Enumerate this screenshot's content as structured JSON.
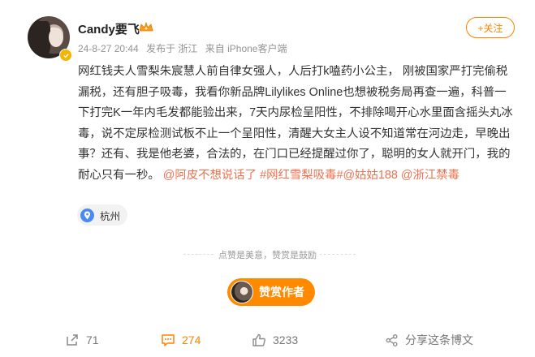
{
  "post": {
    "username": "Candy要飞",
    "date": "24-8-27 20:44",
    "published_from": "发布于 浙江",
    "source": "来自 iPhone客户端",
    "follow_label": "+关注",
    "content_plain": "网红钱夫人雪梨朱宸慧人前自律女强人，人后打k嗑药小公主， 刚被国家严打完偷税漏税，还有胆子吸毒，我看你新品牌Lilylikes Online也想被税务局再查一遍，科普一下打完K一年内毛发都能验出来，7天内尿检呈阳性，不排除喝开心水里面含摇头丸冰毒，说不定尿检测试板不止一个呈阳性，清醒大女主人设不知道常在河边走，早晚出事？还有、我是他老婆，合法的，在门口已经提醒过你了，聪明的女人就开门，我的耐心只有一秒。",
    "mention_1": "@阿皮不想说话了",
    "hashtag": "#网红雪梨吸毒#",
    "mention_2": "@姑姑188",
    "mention_3": "@浙江禁毒",
    "location": "杭州"
  },
  "reward": {
    "divider_text": "点赞是美意，赞赏是鼓励",
    "button_label": "赞赏作者"
  },
  "actions": {
    "repost_count": "71",
    "comment_count": "274",
    "like_count": "3233",
    "share_label": "分享这条博文"
  },
  "colors": {
    "accent_orange": "#ff8200",
    "link_color": "#eb7350",
    "verified_gold": "#f5b400",
    "location_pin": "#4a8af4"
  },
  "icons": [
    "avatar",
    "verified-badge-icon",
    "crown-icon",
    "location-pin-icon",
    "repost-icon",
    "comment-icon",
    "like-icon",
    "share-icon"
  ]
}
